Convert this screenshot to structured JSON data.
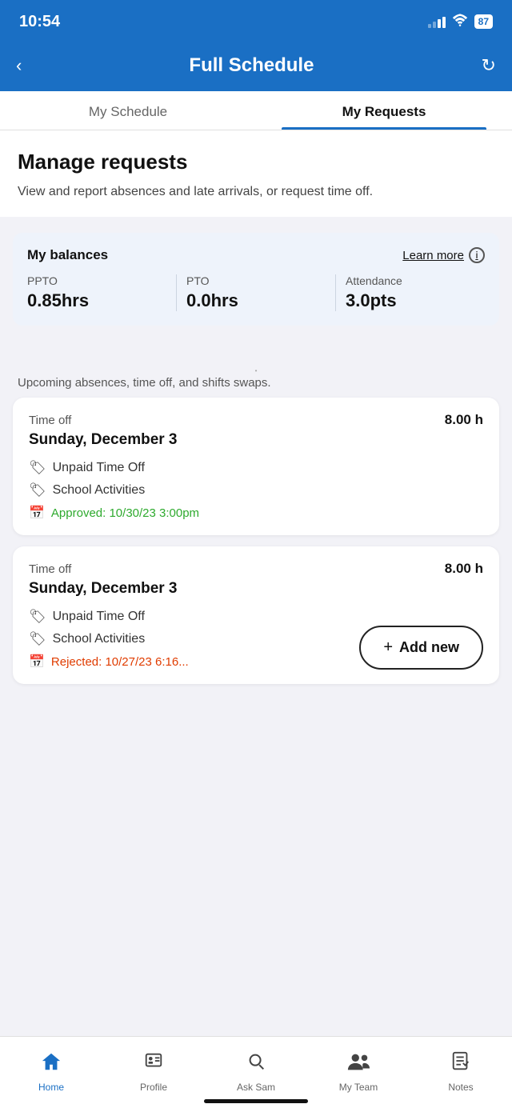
{
  "statusBar": {
    "time": "10:54",
    "battery": "87"
  },
  "header": {
    "title": "Full Schedule",
    "backLabel": "‹",
    "refreshLabel": "↻"
  },
  "tabs": [
    {
      "id": "my-schedule",
      "label": "My Schedule",
      "active": false
    },
    {
      "id": "my-requests",
      "label": "My Requests",
      "active": true
    }
  ],
  "managePage": {
    "title": "Manage requests",
    "description": "View and report absences and late arrivals, or request time off."
  },
  "balances": {
    "title": "My balances",
    "learnMore": "Learn more",
    "items": [
      {
        "label": "PPTO",
        "value": "0.85hrs"
      },
      {
        "label": "PTO",
        "value": "0.0hrs"
      },
      {
        "label": "Attendance",
        "value": "3.0pts"
      }
    ]
  },
  "upcomingText": "Upcoming absences, time off, and shifts swaps.",
  "dotIndicator": "•",
  "cards": [
    {
      "type": "Time off",
      "hours": "8.00 h",
      "date": "Sunday, December 3",
      "details": [
        {
          "label": "Unpaid Time Off"
        },
        {
          "label": "School Activities"
        }
      ],
      "statusColor": "approved",
      "statusText": "Approved:  10/30/23 3:00pm"
    },
    {
      "type": "Time off",
      "hours": "8.00 h",
      "date": "Sunday, December 3",
      "details": [
        {
          "label": "Unpaid Time Off"
        },
        {
          "label": "School Activities"
        }
      ],
      "statusColor": "rejected",
      "statusText": "Rejected: 10/27/23 6:16..."
    }
  ],
  "addNew": "+ Add new",
  "bottomNav": [
    {
      "id": "home",
      "label": "Home",
      "active": true
    },
    {
      "id": "profile",
      "label": "Profile",
      "active": false
    },
    {
      "id": "ask-sam",
      "label": "Ask Sam",
      "active": false
    },
    {
      "id": "my-team",
      "label": "My Team",
      "active": false
    },
    {
      "id": "notes",
      "label": "Notes",
      "active": false
    }
  ]
}
